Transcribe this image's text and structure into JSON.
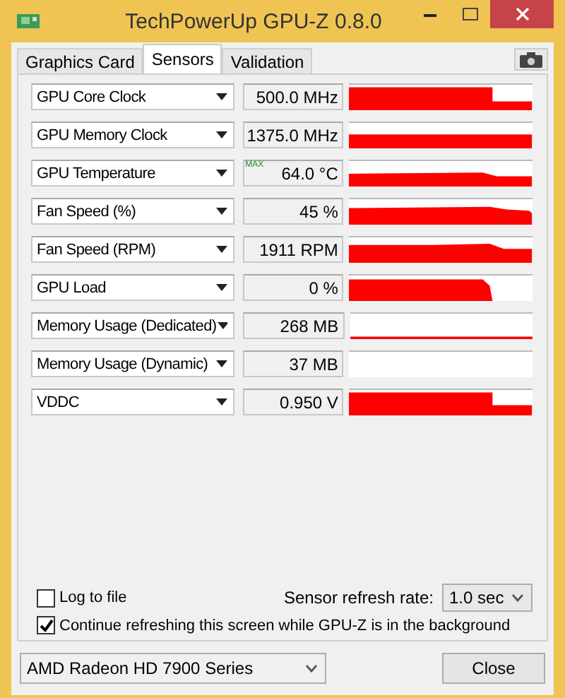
{
  "window": {
    "title": "TechPowerUp GPU-Z 0.8.0"
  },
  "tabs": [
    {
      "label": "Graphics Card",
      "selected": false
    },
    {
      "label": "Sensors",
      "selected": true
    },
    {
      "label": "Validation",
      "selected": false
    }
  ],
  "sensors": [
    {
      "name": "GPU Core Clock",
      "reading": "500.0 MHz"
    },
    {
      "name": "GPU Memory Clock",
      "reading": "1375.0 MHz"
    },
    {
      "name": "GPU Temperature",
      "reading": "64.0 °C",
      "badge": "MAX"
    },
    {
      "name": "Fan Speed (%)",
      "reading": "45 %"
    },
    {
      "name": "Fan Speed (RPM)",
      "reading": "1911 RPM"
    },
    {
      "name": "GPU Load",
      "reading": "0 %"
    },
    {
      "name": "Memory Usage (Dedicated)",
      "reading": "268 MB"
    },
    {
      "name": "Memory Usage (Dynamic)",
      "reading": "37 MB"
    },
    {
      "name": "VDDC",
      "reading": "0.950 V"
    }
  ],
  "options": [
    {
      "label": "Log to file",
      "checked": false
    },
    {
      "label": "Continue refreshing this screen while GPU-Z is in the background",
      "checked": true
    }
  ],
  "refresh": {
    "label": "Sensor refresh rate:",
    "value": "1.0 sec"
  },
  "device": {
    "value": "AMD Radeon HD 7900 Series"
  },
  "buttons": [
    "Close"
  ]
}
